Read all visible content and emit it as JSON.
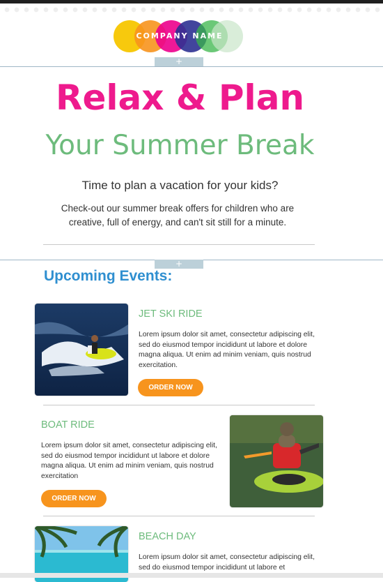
{
  "logo": {
    "text": "COMPANY NAME",
    "circle_colors": [
      "#f7c600",
      "#f7941d",
      "#ec008c",
      "#2e3192",
      "#39b54a",
      "#c9e5c9"
    ]
  },
  "editor": {
    "plus": "+"
  },
  "hero": {
    "headline": "Relax & Plan",
    "subheadline": "Your Summer Break",
    "tagline": "Time to plan a vacation for your kids?",
    "description": "Check-out our summer break offers for children who are creative, full of energy, and can't sit still for a minute."
  },
  "events": {
    "heading": "Upcoming Events:",
    "items": [
      {
        "title": "JET SKI RIDE",
        "text": "Lorem ipsum dolor sit amet, consectetur adipiscing elit, sed do eiusmod tempor incididunt ut labore et dolore magna aliqua. Ut enim ad minim veniam, quis nostrud exercitation.",
        "button": "ORDER NOW",
        "image": "jet-ski-photo"
      },
      {
        "title": "BOAT RIDE",
        "text": "Lorem ipsum dolor sit amet, consectetur adipiscing elit, sed do eiusmod tempor incididunt ut labore et dolore magna aliqua. Ut enim ad minim veniam, quis nostrud exercitation",
        "button": "ORDER NOW",
        "image": "kayak-photo"
      },
      {
        "title": "BEACH DAY",
        "text": "Lorem ipsum dolor sit amet, consectetur adipiscing elit, sed do eiusmod tempor incididunt ut labore et",
        "image": "beach-photo"
      }
    ]
  },
  "colors": {
    "pink": "#ee1a8d",
    "green": "#6dbb7c",
    "blue": "#2f8fd0",
    "orange": "#f7941d"
  }
}
